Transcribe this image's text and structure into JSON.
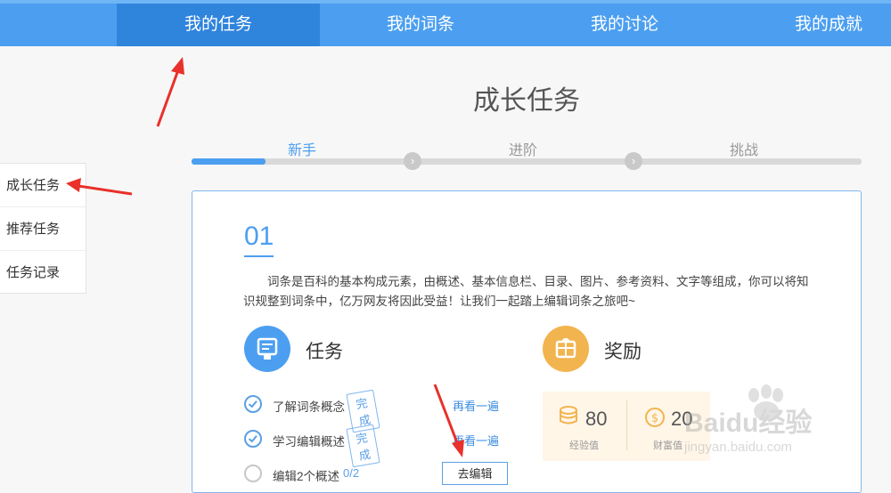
{
  "nav": {
    "tabs": [
      {
        "label": "我的任务",
        "active": true
      },
      {
        "label": "我的词条",
        "active": false
      },
      {
        "label": "我的讨论",
        "active": false
      },
      {
        "label": "我的成就",
        "active": false
      }
    ]
  },
  "page": {
    "title": "成长任务"
  },
  "stages": [
    "新手",
    "进阶",
    "挑战"
  ],
  "stage_progress_fraction": 0.11,
  "sidebar": {
    "items": [
      "成长任务",
      "推荐任务",
      "任务记录"
    ]
  },
  "card": {
    "number": "01",
    "intro": "词条是百科的基本构成元素，由概述、基本信息栏、目录、图片、参考资料、文字等组成，你可以将知识规整到词条中，亿万网友将因此受益！让我们一起踏上编辑词条之旅吧~",
    "task_section_title": "任务",
    "reward_section_title": "奖励",
    "tasks": [
      {
        "text": "了解词条概念",
        "status": "完成",
        "link": "再看一遍"
      },
      {
        "text": "学习编辑概述",
        "status": "完成",
        "link": "再看一遍"
      },
      {
        "text": "编辑2个概述",
        "progress": "0/2",
        "action": "去编辑"
      }
    ],
    "rewards": {
      "exp_value": "80",
      "exp_label": "经验值",
      "wealth_value": "20",
      "wealth_label": "财富值"
    }
  },
  "watermark": {
    "brand": "Baidu经验",
    "url": "jingyan.baidu.com"
  },
  "colors": {
    "accent": "#4c9ff0",
    "nav_active": "#2f84dc",
    "reward_gold": "#f2b44f",
    "arrow_red": "#e8312a"
  },
  "icons": [
    "check-circle-icon",
    "task-doc-icon",
    "reward-box-icon",
    "coin-stack-icon",
    "dollar-coin-icon",
    "chevron-right-icon"
  ]
}
